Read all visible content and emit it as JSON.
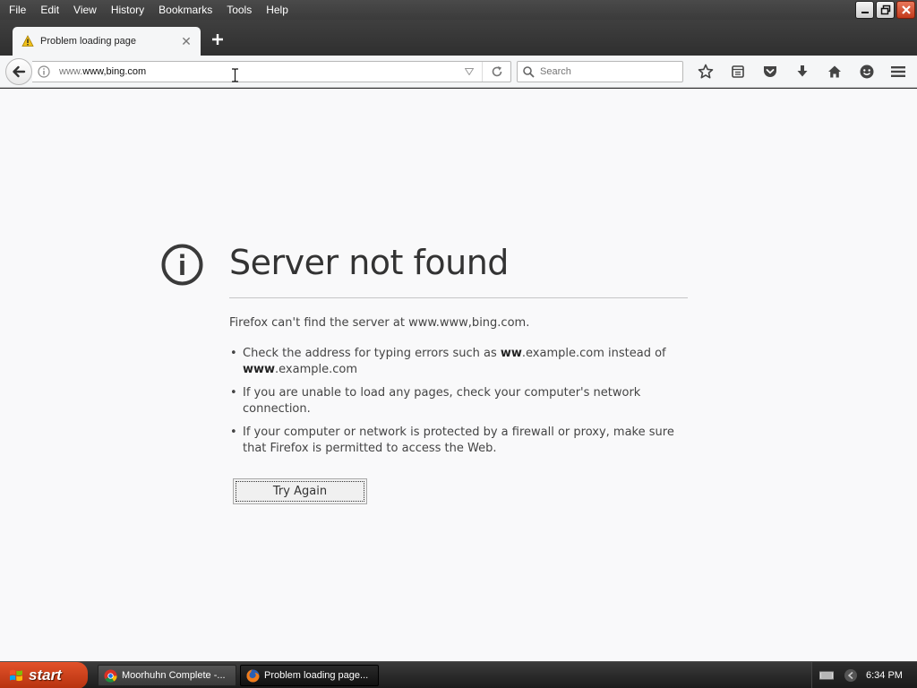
{
  "menu": [
    {
      "label": "File"
    },
    {
      "label": "Edit"
    },
    {
      "label": "View"
    },
    {
      "label": "History"
    },
    {
      "label": "Bookmarks"
    },
    {
      "label": "Tools"
    },
    {
      "label": "Help"
    }
  ],
  "window_controls": {
    "minimize_icon": "minimize-icon",
    "restore_icon": "restore-icon",
    "close_icon": "close-icon"
  },
  "tab": {
    "title": "Problem loading page",
    "icon": "warning-icon"
  },
  "navbar": {
    "url_prefix": "www.",
    "url_main": "www,bing.com",
    "search_placeholder": "Search",
    "toolbar_icons": [
      "bookmark-star-icon",
      "reading-list-icon",
      "pocket-icon",
      "download-icon",
      "home-icon",
      "hello-icon"
    ]
  },
  "error": {
    "title": "Server not found",
    "description": "Firefox can't find the server at www.www,bing.com.",
    "bullet1_pre": "Check the address for typing errors such as ",
    "bullet1_bold1": "ww",
    "bullet1_mid": ".example.com instead of ",
    "bullet1_bold2": "www",
    "bullet1_post": ".example.com",
    "bullet2": "If you are unable to load any pages, check your computer's network connection.",
    "bullet3": "If your computer or network is protected by a firewall or proxy, make sure that Firefox is permitted to access the Web.",
    "try_again": "Try Again"
  },
  "taskbar": {
    "start": "start",
    "tasks": [
      {
        "label": "Moorhuhn Complete -..."
      },
      {
        "label": "Problem loading page..."
      }
    ],
    "clock": "6:34 PM"
  },
  "colors": {
    "start_button": "#c8401a",
    "title_bar": "#3b3b3b",
    "page_bg": "#f9f9fa"
  }
}
